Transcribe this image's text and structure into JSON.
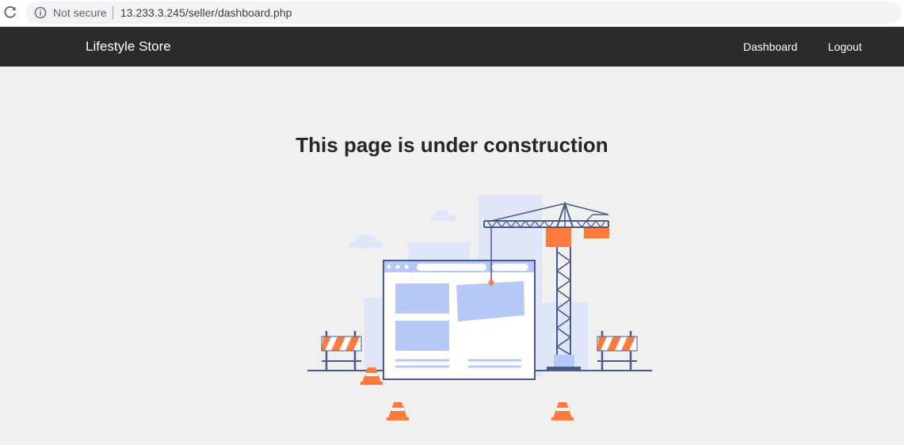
{
  "browser": {
    "security_label": "Not secure",
    "url": "13.233.3.245/seller/dashboard.php"
  },
  "navbar": {
    "brand": "Lifestyle Store",
    "links": [
      {
        "label": "Dashboard"
      },
      {
        "label": "Logout"
      }
    ]
  },
  "main": {
    "title": "This page is under construction",
    "illustration_icon": "under-construction-illustration"
  },
  "colors": {
    "navbar_bg": "#2b2b2b",
    "page_bg": "#f0f0f0",
    "accent_orange": "#ff7a3d",
    "illustration_blue": "#4a5a8c",
    "light_blue": "#b6c8f5"
  }
}
